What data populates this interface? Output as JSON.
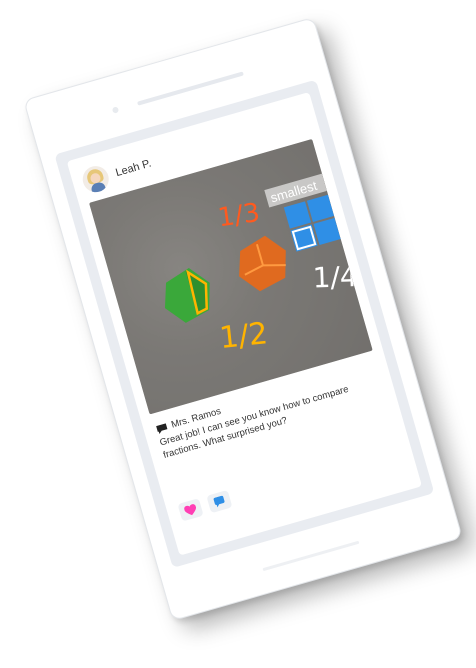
{
  "post": {
    "author": "Leah P.",
    "photo_labels": {
      "smallest": "smallest",
      "one_third": "1/3",
      "one_half": "1/2",
      "one_fourth": "1/4"
    },
    "comment_author": "Mrs. Ramos",
    "comment_text": "Great job! I can see you know how to compare fractions. What surprised you?"
  },
  "icons": {
    "avatar": "student-avatar",
    "comment": "speech-bubble-icon",
    "like": "heart-icon",
    "reply": "comment-icon"
  },
  "colors": {
    "green_piece": "#3aa83a",
    "orange_piece": "#e06a1f",
    "blue_piece": "#2f8fe6",
    "annotation_yellow": "#ffb400",
    "annotation_orange": "#ff5a1f",
    "heart_pink": "#ff3fb4",
    "bubble_blue": "#2f8fe6"
  }
}
